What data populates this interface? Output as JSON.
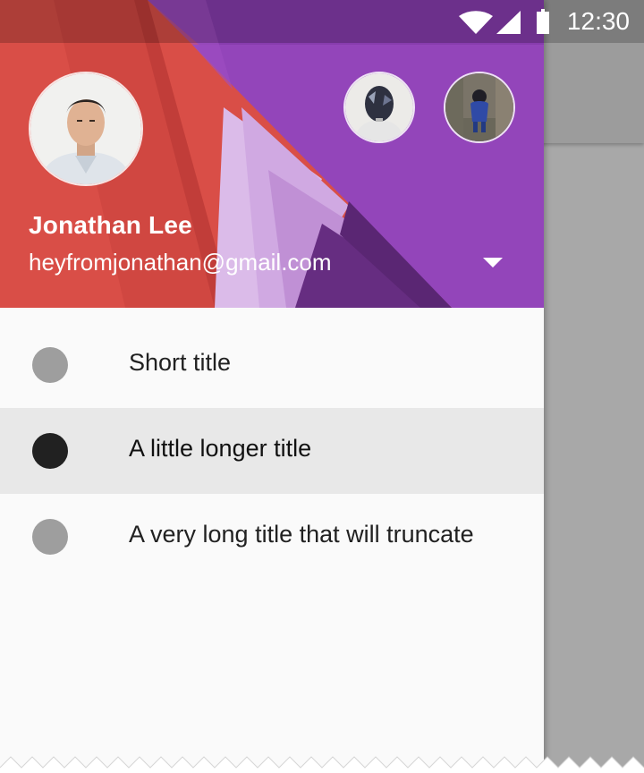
{
  "status_bar": {
    "time": "12:30",
    "icons": [
      "wifi-icon",
      "cell-signal-icon",
      "battery-icon"
    ]
  },
  "account": {
    "name": "Jonathan Lee",
    "email": "heyfromjonathan@gmail.com",
    "dropdown_icon": "arrow-drop-down-icon"
  },
  "nav_items": [
    {
      "label": "Short title",
      "icon_color": "#9e9e9e",
      "active": false
    },
    {
      "label": "A little longer title",
      "icon_color": "#212121",
      "active": true
    },
    {
      "label": "A very long title that will truncate",
      "icon_color": "#9e9e9e",
      "active": false
    }
  ],
  "colors": {
    "header_red": "#e2524a",
    "header_purple": "#8e3fb6",
    "drawer_bg": "#fafafa",
    "scrim": "#a8a8a8",
    "active_item_bg": "#e8e8e8"
  }
}
